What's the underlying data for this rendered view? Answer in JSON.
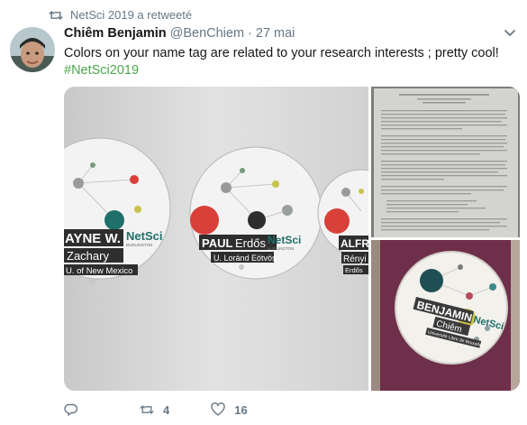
{
  "retweet": {
    "text": "NetSci 2019 a retweeté"
  },
  "tweet": {
    "author_name": "Chiêm Benjamin",
    "handle": "@BenChiem",
    "separator": "·",
    "date": "27 mai",
    "text": "Colors on your name tag are related to your research interests ; pretty cool!",
    "hashtag": "#NetSci2019"
  },
  "media": {
    "badge_left_first": "AYNE W.",
    "badge_left_last": "Zachary",
    "badge_left_affil": "U. of New Mexico",
    "badge_mid_first": "PAUL",
    "badge_mid_last": "Erdős",
    "badge_mid_affil": "U. Loránd Eötvös",
    "badge_right_first": "ALFR",
    "badge_right_last": "Rényi",
    "badge_right_affil": "Erdős",
    "logo": "NetSci",
    "logo_sub": "BURLINGTON",
    "button_first": "BENJAMIN",
    "button_last": "Chiêm",
    "button_affil": "Université Libre de Bruxelles"
  },
  "actions": {
    "reply_count": "",
    "retweet_count": "4",
    "like_count": "16"
  },
  "colors": {
    "hashtag": "#4ca64c",
    "muted": "#657786",
    "accent_red": "#d9403a",
    "accent_teal": "#1f6f6a",
    "accent_yellow": "#c8c44a"
  }
}
